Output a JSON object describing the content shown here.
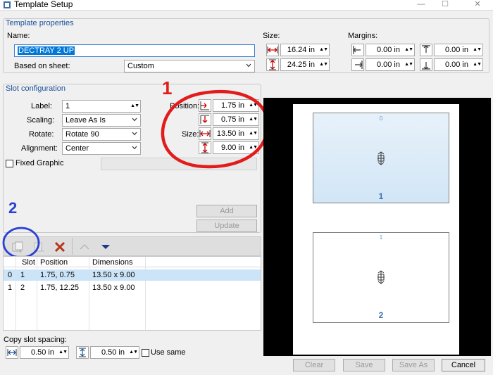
{
  "window": {
    "title": "Template Setup",
    "minimize": "—",
    "maximize": "☐",
    "close": "✕"
  },
  "template_properties": {
    "title": "Template properties",
    "name_label": "Name:",
    "name_value": "DECTRAY 2 UP",
    "based_on_label": "Based on sheet:",
    "based_on_value": "Custom",
    "size_label": "Size:",
    "width": "16.24 in",
    "height": "24.25 in",
    "margins_label": "Margins:",
    "margin_left": "0.00 in",
    "margin_top": "0.00 in",
    "margin_right": "0.00 in",
    "margin_bottom": "0.00 in"
  },
  "slot_configuration": {
    "title": "Slot configuration",
    "label_label": "Label:",
    "label_value": "1",
    "scaling_label": "Scaling:",
    "scaling_value": "Leave As Is",
    "rotate_label": "Rotate:",
    "rotate_value": "Rotate 90",
    "alignment_label": "Alignment:",
    "alignment_value": "Center",
    "fixed_graphic_label": "Fixed Graphic",
    "position_label": "Position:",
    "position_x": "1.75 in",
    "position_y": "0.75 in",
    "size_label": "Size:",
    "size_w": "13.50 in",
    "size_h": "9.00 in",
    "add_label": "Add",
    "update_label": "Update"
  },
  "annotations": {
    "one": "1",
    "two": "2"
  },
  "slot_table": {
    "columns": [
      "Slot",
      "Position",
      "Dimensions"
    ],
    "rows": [
      {
        "index": "0",
        "slot": "1",
        "position": "1.75, 0.75",
        "dimensions": "13.50 x 9.00"
      },
      {
        "index": "1",
        "slot": "2",
        "position": "1.75, 12.25",
        "dimensions": "13.50 x 9.00"
      }
    ]
  },
  "copy_spacing": {
    "label": "Copy slot spacing:",
    "horizontal": "0.50 in",
    "vertical": "0.50 in",
    "use_same_label": "Use same"
  },
  "preview": {
    "slots": [
      {
        "index": "0",
        "number": "1"
      },
      {
        "index": "1",
        "number": "2"
      }
    ]
  },
  "footer": {
    "clear_label": "Clear",
    "save_label": "Save",
    "save_as_label": "Save As",
    "cancel_label": "Cancel"
  },
  "colors": {
    "accent": "#1a4f9c",
    "annotation_red": "#e21b1b",
    "annotation_blue": "#2a3fd6",
    "selection": "#cce4f7"
  }
}
